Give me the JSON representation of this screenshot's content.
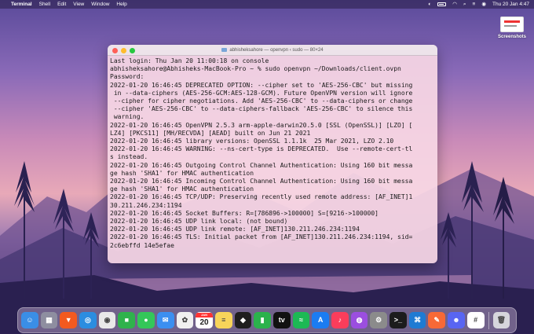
{
  "menubar": {
    "apple_glyph": "",
    "items": [
      "Terminal",
      "Shell",
      "Edit",
      "View",
      "Window",
      "Help"
    ],
    "datetime": "Thu 20 Jan  4:47"
  },
  "desktop": {
    "icon_label": "Screenshots"
  },
  "terminal": {
    "title": "abhisheksahore — openvpn ‹ sudo — 80×24",
    "lines": [
      "Last login: Thu Jan 20 11:00:18 on console",
      "abhisheksahore@Abhisheks-MacBook-Pro ~ % sudo openvpn ~/Downloads/client.ovpn",
      "Password:",
      "2022-01-20 16:46:45 DEPRECATED OPTION: --cipher set to 'AES-256-CBC' but missing",
      " in --data-ciphers (AES-256-GCM:AES-128-GCM). Future OpenVPN version will ignore",
      " --cipher for cipher negotiations. Add 'AES-256-CBC' to --data-ciphers or change",
      " --cipher 'AES-256-CBC' to --data-ciphers-fallback 'AES-256-CBC' to silence this",
      " warning.",
      "2022-01-20 16:46:45 OpenVPN 2.5.3 arm-apple-darwin20.5.0 [SSL (OpenSSL)] [LZO] [",
      "LZ4] [PKCS11] [MH/RECVDA] [AEAD] built on Jun 21 2021",
      "2022-01-20 16:46:45 library versions: OpenSSL 1.1.1k  25 Mar 2021, LZO 2.10",
      "2022-01-20 16:46:45 WARNING: --ns-cert-type is DEPRECATED.  Use --remote-cert-tl",
      "s instead.",
      "2022-01-20 16:46:45 Outgoing Control Channel Authentication: Using 160 bit messa",
      "ge hash 'SHA1' for HMAC authentication",
      "2022-01-20 16:46:45 Incoming Control Channel Authentication: Using 160 bit messa",
      "ge hash 'SHA1' for HMAC authentication",
      "2022-01-20 16:46:45 TCP/UDP: Preserving recently used remote address: [AF_INET]1",
      "30.211.246.234:1194",
      "2022-01-20 16:46:45 Socket Buffers: R=[786896->100000] S=[9216->100000]",
      "2022-01-20 16:46:45 UDP link local: (not bound)",
      "2022-01-20 16:46:45 UDP link remote: [AF_INET]130.211.246.234:1194",
      "2022-01-20 16:46:45 TLS: Initial packet from [AF_INET]130.211.246.234:1194, sid=",
      "2c6ebffd 14e5efae"
    ]
  },
  "dock": {
    "calendar": {
      "month": "JAN",
      "day": "20"
    },
    "apps": [
      {
        "name": "finder-icon",
        "glyph": "☺",
        "color": "#3a8ee6"
      },
      {
        "name": "launchpad-icon",
        "glyph": "▦",
        "color": "#8e8ea0"
      },
      {
        "name": "brave-browser-icon",
        "glyph": "▼",
        "color": "#f25a1f"
      },
      {
        "name": "safari-icon",
        "glyph": "◎",
        "color": "#2b8de0"
      },
      {
        "name": "chrome-icon",
        "glyph": "◉",
        "color": "#e9e9e9"
      },
      {
        "name": "facetime-icon",
        "glyph": "■",
        "color": "#2fb24c"
      },
      {
        "name": "messages-icon",
        "glyph": "●",
        "color": "#34c759"
      },
      {
        "name": "mail-icon",
        "glyph": "✉",
        "color": "#3b8ff0"
      },
      {
        "name": "photos-icon",
        "glyph": "✿",
        "color": "#f0f0f0"
      },
      {
        "name": "calendar-icon",
        "glyph": "",
        "color": "#ffffff"
      },
      {
        "name": "notes-icon",
        "glyph": "≡",
        "color": "#f7d45a"
      },
      {
        "name": "figma-icon",
        "glyph": "◆",
        "color": "#1e1e1e"
      },
      {
        "name": "numbers-icon",
        "glyph": "▮",
        "color": "#2bb24c"
      },
      {
        "name": "apple-tv-icon",
        "glyph": "tv",
        "color": "#111111"
      },
      {
        "name": "spotify-icon",
        "glyph": "≈",
        "color": "#1db954"
      },
      {
        "name": "app-store-icon",
        "glyph": "A",
        "color": "#1b7cf2"
      },
      {
        "name": "music-icon",
        "glyph": "♪",
        "color": "#fb3d5b"
      },
      {
        "name": "podcasts-icon",
        "glyph": "◍",
        "color": "#9b4ee0"
      },
      {
        "name": "system-preferences-icon",
        "glyph": "⚙",
        "color": "#8b8b8b"
      },
      {
        "name": "terminal-icon",
        "glyph": ">_",
        "color": "#1c1c1c"
      },
      {
        "name": "vscode-icon",
        "glyph": "⌘",
        "color": "#1f7bd3"
      },
      {
        "name": "postman-icon",
        "glyph": "✎",
        "color": "#f76936"
      },
      {
        "name": "discord-icon",
        "glyph": "☻",
        "color": "#5865f2"
      },
      {
        "name": "slack-icon",
        "glyph": "#",
        "color": "#ffffff"
      },
      {
        "name": "trash-icon",
        "glyph": "🗑",
        "color": "#d6d6dc"
      }
    ]
  }
}
